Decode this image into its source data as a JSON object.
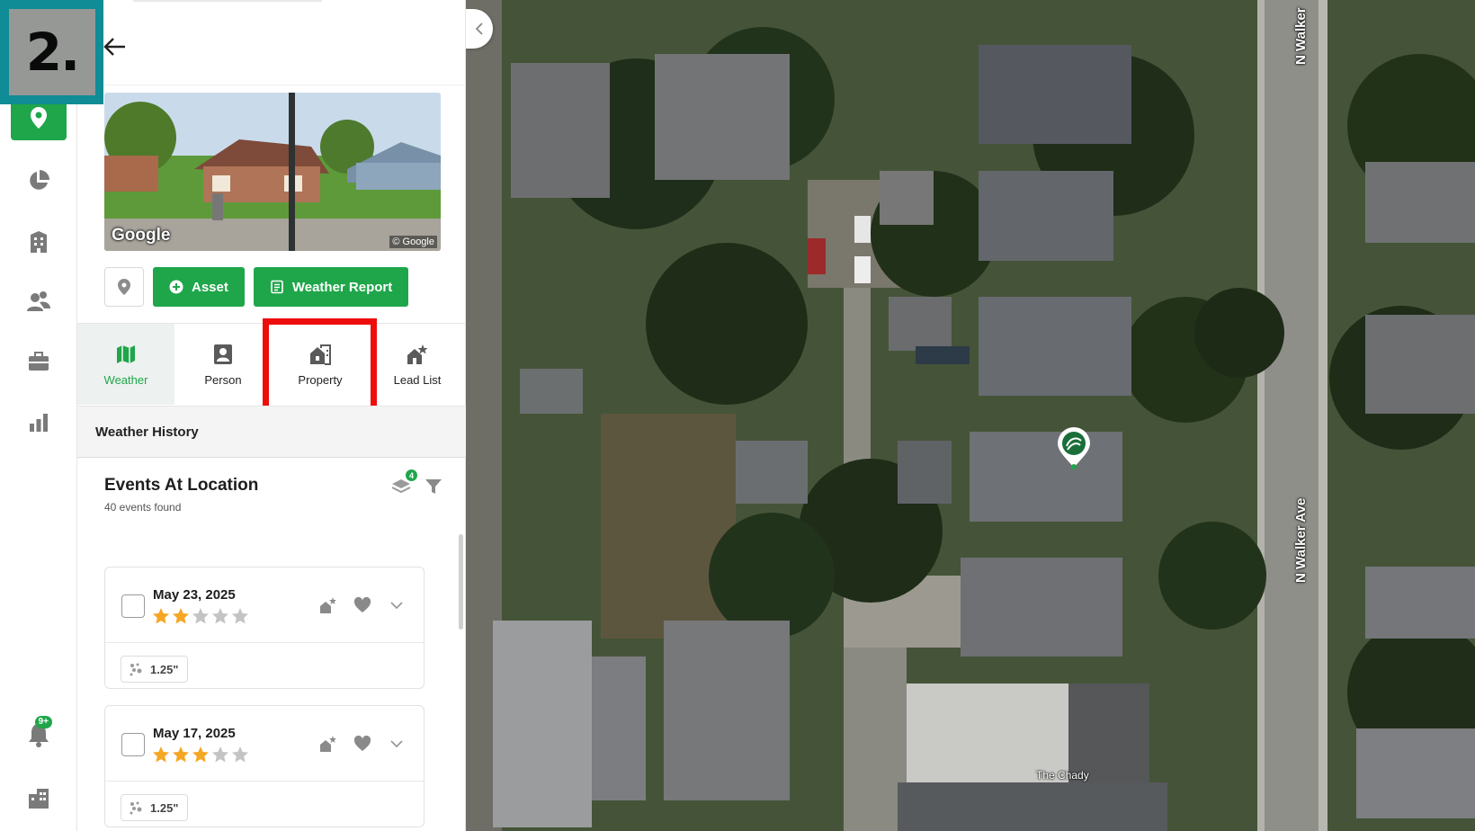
{
  "step_label": "2.",
  "photo": {
    "watermark": "Google",
    "copyright": "© Google"
  },
  "actions": {
    "asset_label": "Asset",
    "weather_report_label": "Weather Report"
  },
  "tabs": [
    {
      "label": "Weather",
      "icon": "map-icon",
      "active": true
    },
    {
      "label": "Person",
      "icon": "person-card-icon",
      "active": false
    },
    {
      "label": "Property",
      "icon": "property-icon",
      "active": false
    },
    {
      "label": "Lead List",
      "icon": "lead-list-icon",
      "active": false
    }
  ],
  "weather_history": {
    "label": "Weather History"
  },
  "events": {
    "title": "Events At Location",
    "count_text": "40 events found",
    "layers_badge": "4",
    "items": [
      {
        "date": "May 23, 2025",
        "rating": 2,
        "max_rating": 5,
        "hail_size": "1.25\""
      },
      {
        "date": "May 17, 2025",
        "rating": 3,
        "max_rating": 5,
        "hail_size": "1.25\""
      }
    ]
  },
  "sidebar": {
    "items": [
      "location-pin-icon",
      "pie-chart-icon",
      "building-icon",
      "people-icon",
      "briefcase-icon",
      "bar-chart-icon",
      "bell-icon",
      "buildings-icon"
    ],
    "bell_badge": "9+"
  },
  "map": {
    "street_labels": [
      "N Walker",
      "N Walker Ave"
    ],
    "place_label": "The Chady"
  },
  "colors": {
    "accent": "#1fa64a",
    "highlight": "#ee0d0d",
    "step_badge_bg": "#0f8c95",
    "star_filled": "#f5a623",
    "star_empty": "#c4c4c4"
  }
}
